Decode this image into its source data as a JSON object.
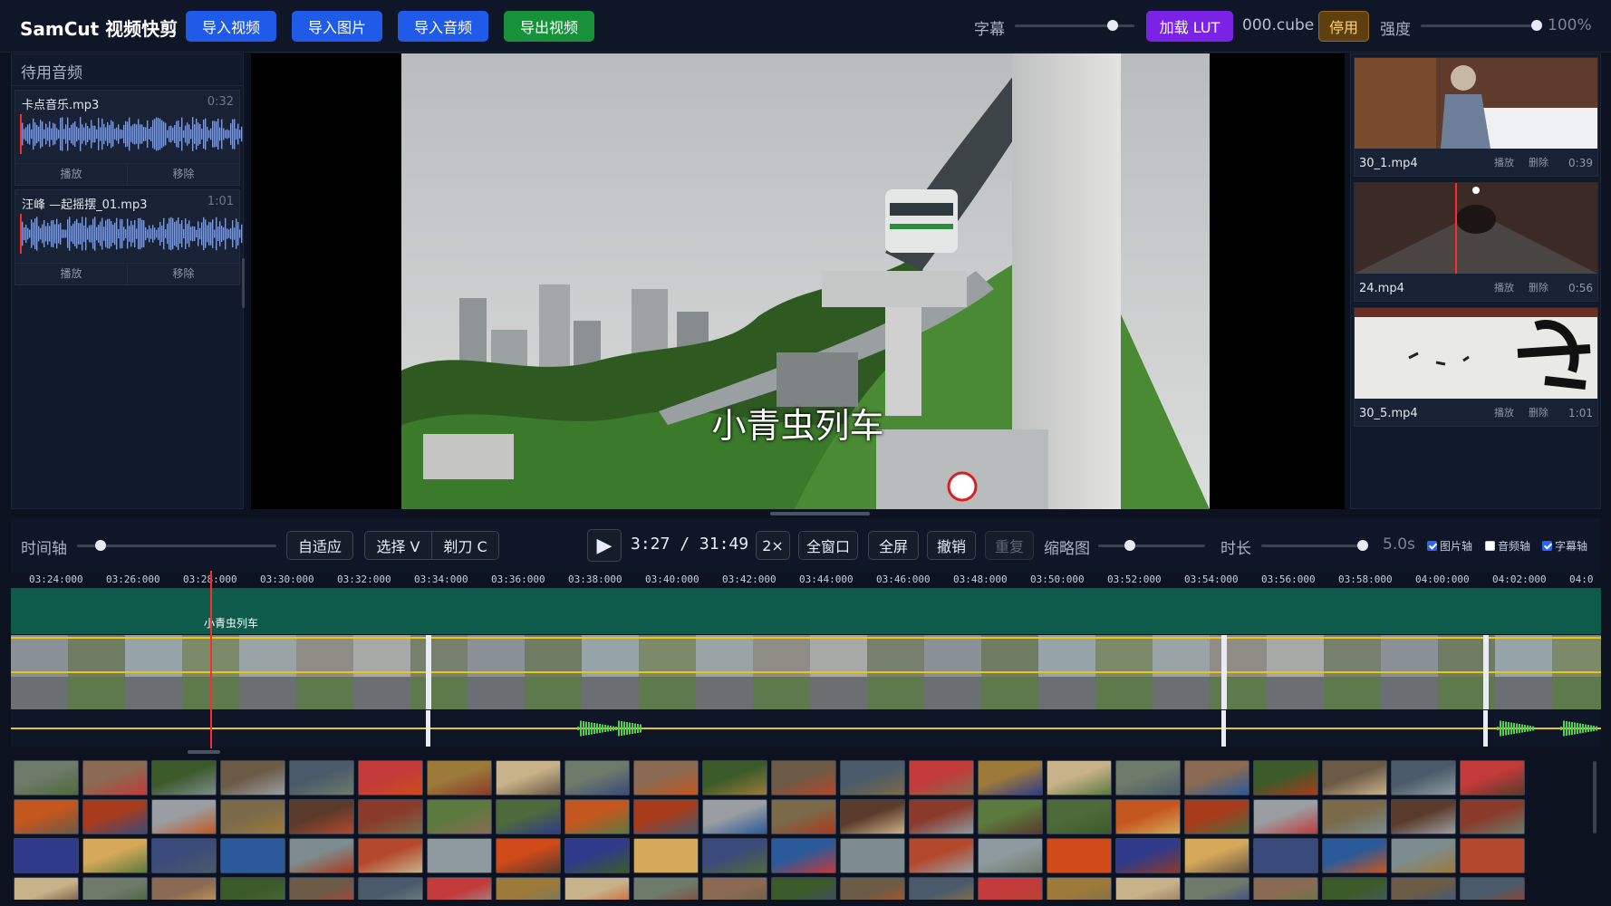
{
  "app": {
    "title": "SamCut 视频快剪"
  },
  "toolbar": {
    "import_video": "导入视频",
    "import_image": "导入图片",
    "import_audio": "导入音频",
    "export_video": "导出视频",
    "subtitle_label": "字幕",
    "subtitle_level": 0.82,
    "load_lut": "加载 LUT",
    "lut_file": "000.cube",
    "disable": "停用",
    "strength_label": "强度",
    "strength_level": 1.0,
    "strength_value": "100%"
  },
  "audio_panel": {
    "title": "待用音频",
    "items": [
      {
        "name": "卡点音乐.mp3",
        "duration": "0:32",
        "play": "播放",
        "remove": "移除"
      },
      {
        "name": "汪峰 —起摇摆_01.mp3",
        "duration": "1:01",
        "play": "播放",
        "remove": "移除"
      }
    ]
  },
  "preview": {
    "subtitle": "小青虫列车"
  },
  "clips": [
    {
      "name": "30_1.mp4",
      "play": "播放",
      "delete": "删除",
      "duration": "0:39"
    },
    {
      "name": "24.mp4",
      "play": "播放",
      "delete": "删除",
      "duration": "0:56"
    },
    {
      "name": "30_5.mp4",
      "play": "播放",
      "delete": "删除",
      "duration": "1:01"
    }
  ],
  "controls": {
    "timeline_label": "时间轴",
    "timeline_zoom": 0.12,
    "fit": "自适应",
    "select": "选择 V",
    "razor": "剃刀 C",
    "current_time": "3:27",
    "separator": "/",
    "total_time": "31:49",
    "speed": "2×",
    "full_window": "全窗口",
    "fullscreen": "全屏",
    "undo": "撤销",
    "redo": "重复",
    "thumb_label": "缩略图",
    "thumb_level": 0.3,
    "duration_label": "时长",
    "duration_level": 1.0,
    "duration_value": "5.0s",
    "image_track": "图片轴",
    "image_track_on": true,
    "audio_track": "音频轴",
    "audio_track_on": false,
    "subtitle_track": "字幕轴",
    "subtitle_track_on": true
  },
  "ruler": [
    "03:24:000",
    "03:26:000",
    "03:28:000",
    "03:30:000",
    "03:32:000",
    "03:34:000",
    "03:36:000",
    "03:38:000",
    "03:40:000",
    "03:42:000",
    "03:44:000",
    "03:46:000",
    "03:48:000",
    "03:50:000",
    "03:52:000",
    "03:54:000",
    "03:56:000",
    "03:58:000",
    "04:00:000",
    "04:02:000",
    "04:0"
  ],
  "subtitle_track": {
    "label": "小青虫列车"
  },
  "colors": {
    "accent_blue": "#1f5be8",
    "export_green": "#17923a",
    "lut_purple": "#7a22e6",
    "playhead": "#ff2a2a",
    "subtitle_track": "#0e5b4b",
    "track_line": "#e6c619"
  }
}
